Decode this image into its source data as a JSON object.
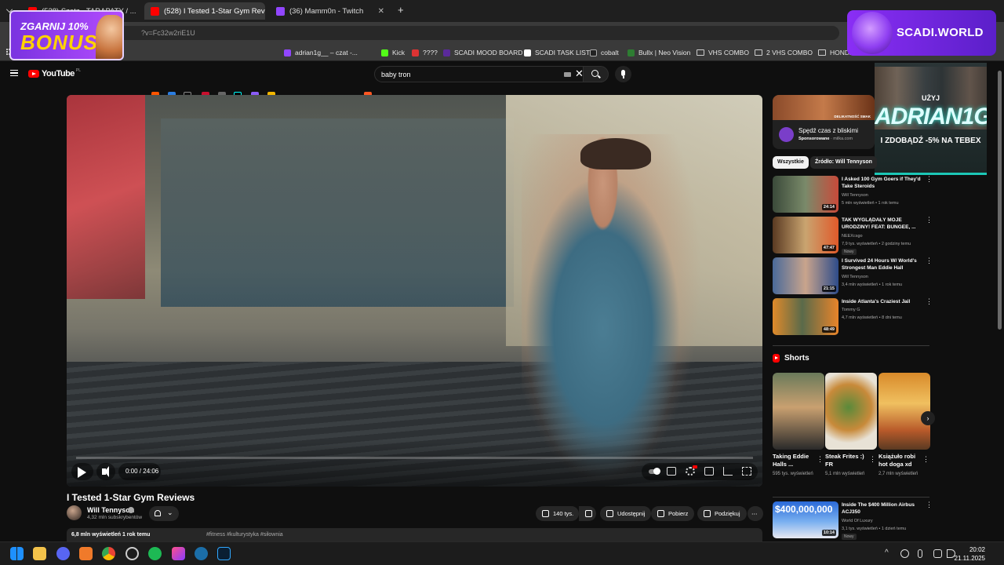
{
  "browser": {
    "tabs": [
      {
        "title": "(528) Szatz - TARAPATY / ...",
        "active": false
      },
      {
        "title": "(528) I Tested 1-Star Gym Review",
        "active": true
      },
      {
        "title": "(36) Mamm0n - Twitch",
        "active": false
      }
    ],
    "new_tab": "+",
    "close_glyph": "✕",
    "url": "?v=Fc32w2riE1U",
    "bookmarks": [
      {
        "label": "adrian1g__ – czat -..."
      },
      {
        "label": "Kick"
      },
      {
        "label": "????"
      },
      {
        "label": "SCADI MOOD BOARD"
      },
      {
        "label": "SCADI TASK LIST"
      },
      {
        "label": "cobalt"
      },
      {
        "label": "Bullx | Neo Vision"
      },
      {
        "label": "VHS COMBO"
      },
      {
        "label": "2 VHS COMBO"
      },
      {
        "label": "HONDA"
      }
    ]
  },
  "overlays": {
    "promo_line1": "ZGARNIJ 10%",
    "promo_line2": "BONUSU",
    "brand": "SCADI.WORLD",
    "code_use": "UŻYJ",
    "code": "ADRIAN1G",
    "code_offer": "I ZDOBĄDŹ -5% NA TEBEX"
  },
  "youtube": {
    "logo": "YouTube",
    "logo_region": "PL",
    "search_value": "baby tron",
    "clear_glyph": "✕"
  },
  "player": {
    "time": "0:00 / 24:06",
    "progress": 0.0
  },
  "video": {
    "title": "I Tested 1-Star Gym Reviews",
    "channel": "Will Tennyson",
    "subscribers": "4,32 mln subskrybentów",
    "bell_chevron": "⌄",
    "likes": "140 tys.",
    "share": "Udostępnij",
    "download": "Pobierz",
    "thanks": "Podziękuj",
    "more": "⋯",
    "meta": "6,8 mln wyświetleń  1 rok temu",
    "tags": "#fitness #kulturystyka #siłownia"
  },
  "sidebar": {
    "ad": {
      "image_text": "DELIKATNOŚĆ SMAK",
      "title": "Spędź czas z bliskimi",
      "sponsored": "Sponsorowane",
      "domain": " · milka.com"
    },
    "chips": [
      "Wszystkie",
      "Źródło: Will Tennyson"
    ],
    "recommended": [
      {
        "title": "I Asked 100 Gym Goers if They'd Take Steroids",
        "channel": "Will Tennyson",
        "views": "5 mln wyświetleń • 1 rok temu",
        "duration": "24:14",
        "badge": ""
      },
      {
        "title": "TAK WYGLĄDAŁY MOJE URODZINY! FEAT: BUNGEE, ...",
        "channel": "NEEXcsgo",
        "views": "7,9 tys. wyświetleń • 2 godziny temu",
        "duration": "47:47",
        "badge": "Nowy"
      },
      {
        "title": "I Survived 24 Hours W/ World's Strongest Man Eddie Hall",
        "channel": "Will Tennyson",
        "views": "3,4 mln wyświetleń • 1 rok temu",
        "duration": "21:15",
        "badge": ""
      },
      {
        "title": "Inside Atlanta's Craziest Jail",
        "channel": "Tommy G",
        "views": "4,7 mln wyświetleń • 8 dni temu",
        "duration": "48:49",
        "badge": ""
      }
    ],
    "shorts_title": "Shorts",
    "shorts": [
      {
        "title": "Taking Eddie Halls ...",
        "views": "595 tys. wyświetleń"
      },
      {
        "title": "Steak Frites :) FR",
        "views": "5,1 mln wyświetleń"
      },
      {
        "title": "Książuło robi hot doga xd",
        "views": "2,7 mln wyświetleń"
      }
    ],
    "next": "›",
    "dots": "⋮",
    "bottom_video": {
      "title": "Inside The $400 Million Airbus ACJ350",
      "channel": "World Of Luxury",
      "views": "3,1 tys. wyświetleń • 1 dzień temu",
      "duration": "10:14",
      "badge": "Nowy",
      "thumb_text": "$400,000,000"
    }
  },
  "taskbar": {
    "time": "20:02",
    "date": "21.11.2025",
    "tray_chevron": "^"
  },
  "colors": {
    "yt_red": "#ff0000",
    "background": "#0f0f0f",
    "chip_active": "#f1f1f1",
    "promo_purple": "#8a2ef5",
    "code_teal": "#1cc7b6"
  }
}
